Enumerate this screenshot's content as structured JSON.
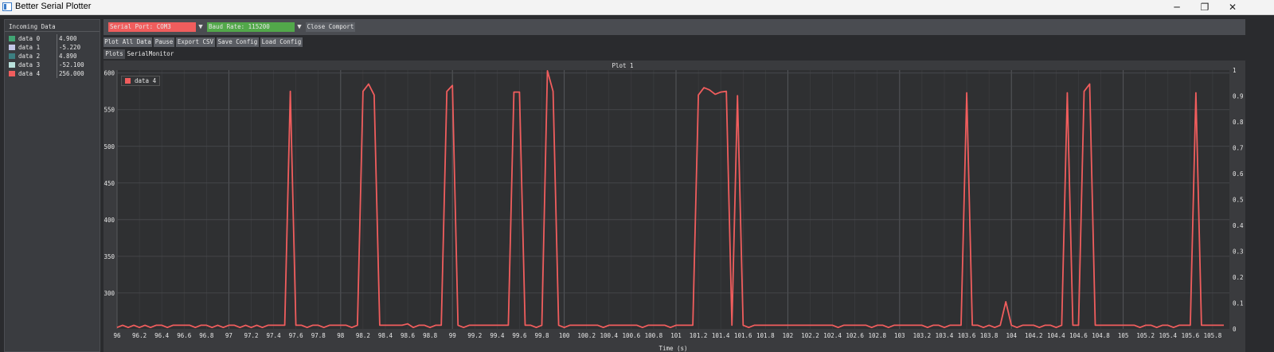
{
  "window": {
    "title": "Better Serial Plotter",
    "minimize_glyph": "─",
    "maximize_glyph": "❐",
    "close_glyph": "✕"
  },
  "incoming": {
    "title": "Incoming Data",
    "channels": [
      {
        "name": "data 0",
        "value": "4.900",
        "color": "#41a574"
      },
      {
        "name": "data 1",
        "value": "-5.220",
        "color": "#c3c6e8"
      },
      {
        "name": "data 2",
        "value": "4.890",
        "color": "#3c7f81"
      },
      {
        "name": "data 3",
        "value": "-52.100",
        "color": "#b9e1dc"
      },
      {
        "name": "data 4",
        "value": "256.000",
        "color": "#f05d5d"
      }
    ]
  },
  "toolbar": {
    "serial_port": "Serial Port: COM3",
    "baud_rate": "Baud Rate: 115200",
    "close_comport": "Close Comport",
    "plot_all": "Plot All Data",
    "pause": "Pause",
    "export_csv": "Export CSV",
    "save_config": "Save Config",
    "load_config": "Load Config",
    "tab_plots": "Plots",
    "tab_monitor": "SerialMonitor",
    "arrow_glyph": "▼"
  },
  "colors": {
    "serial_port_bg": "#f05d5d",
    "baud_rate_bg": "#52a84a",
    "line": "#f05d5d",
    "plot_bg": "#2f3032",
    "grid": "#3f4043"
  },
  "chart_data": {
    "type": "line",
    "title": "Plot 1",
    "xlabel": "Time (s)",
    "ylabel": "",
    "xlim": [
      96,
      105.95
    ],
    "ylim": [
      251,
      604
    ],
    "y2lim": [
      0,
      1
    ],
    "xticks": [
      96,
      96.2,
      96.4,
      96.6,
      96.8,
      97,
      97.2,
      97.4,
      97.6,
      97.8,
      98,
      98.2,
      98.4,
      98.6,
      98.8,
      99,
      99.2,
      99.4,
      99.6,
      99.8,
      100,
      100.2,
      100.4,
      100.6,
      100.8,
      101,
      101.2,
      101.4,
      101.6,
      101.8,
      102,
      102.2,
      102.4,
      102.6,
      102.8,
      103,
      103.2,
      103.4,
      103.6,
      103.8,
      104,
      104.2,
      104.4,
      104.6,
      104.8,
      105,
      105.2,
      105.4,
      105.6,
      105.8
    ],
    "yticks": [
      300,
      350,
      400,
      450,
      500,
      550,
      600
    ],
    "y2ticks": [
      0.1,
      0.2,
      0.3,
      0.4,
      0.5,
      0.6,
      0.7,
      0.8,
      0.9,
      1
    ],
    "series": [
      {
        "name": "data 4",
        "points": [
          [
            96,
            253
          ],
          [
            96.05,
            256
          ],
          [
            96.1,
            253
          ],
          [
            96.15,
            256
          ],
          [
            96.2,
            253
          ],
          [
            96.25,
            256
          ],
          [
            96.3,
            253
          ],
          [
            96.35,
            256
          ],
          [
            96.4,
            256
          ],
          [
            96.45,
            253
          ],
          [
            96.5,
            256
          ],
          [
            96.55,
            256
          ],
          [
            96.6,
            256
          ],
          [
            96.65,
            256
          ],
          [
            96.7,
            253
          ],
          [
            96.75,
            256
          ],
          [
            96.8,
            256
          ],
          [
            96.85,
            253
          ],
          [
            96.9,
            256
          ],
          [
            96.95,
            253
          ],
          [
            97,
            256
          ],
          [
            97.05,
            256
          ],
          [
            97.1,
            253
          ],
          [
            97.15,
            256
          ],
          [
            97.2,
            253
          ],
          [
            97.25,
            256
          ],
          [
            97.3,
            253
          ],
          [
            97.35,
            256
          ],
          [
            97.4,
            256
          ],
          [
            97.45,
            256
          ],
          [
            97.5,
            256
          ],
          [
            97.55,
            575
          ],
          [
            97.6,
            256
          ],
          [
            97.65,
            256
          ],
          [
            97.7,
            253
          ],
          [
            97.75,
            256
          ],
          [
            97.8,
            256
          ],
          [
            97.85,
            253
          ],
          [
            97.9,
            256
          ],
          [
            97.95,
            256
          ],
          [
            98,
            256
          ],
          [
            98.05,
            256
          ],
          [
            98.1,
            253
          ],
          [
            98.15,
            256
          ],
          [
            98.2,
            575
          ],
          [
            98.25,
            585
          ],
          [
            98.3,
            570
          ],
          [
            98.35,
            256
          ],
          [
            98.4,
            256
          ],
          [
            98.45,
            256
          ],
          [
            98.5,
            256
          ],
          [
            98.55,
            256
          ],
          [
            98.6,
            258
          ],
          [
            98.65,
            253
          ],
          [
            98.7,
            256
          ],
          [
            98.75,
            256
          ],
          [
            98.8,
            253
          ],
          [
            98.85,
            256
          ],
          [
            98.9,
            256
          ],
          [
            98.95,
            575
          ],
          [
            99,
            583
          ],
          [
            99.05,
            256
          ],
          [
            99.1,
            253
          ],
          [
            99.15,
            256
          ],
          [
            99.2,
            256
          ],
          [
            99.25,
            256
          ],
          [
            99.3,
            256
          ],
          [
            99.35,
            256
          ],
          [
            99.4,
            256
          ],
          [
            99.45,
            256
          ],
          [
            99.5,
            256
          ],
          [
            99.55,
            574
          ],
          [
            99.6,
            574
          ],
          [
            99.65,
            256
          ],
          [
            99.7,
            256
          ],
          [
            99.75,
            253
          ],
          [
            99.8,
            256
          ],
          [
            99.85,
            603
          ],
          [
            99.9,
            575
          ],
          [
            99.95,
            256
          ],
          [
            100,
            253
          ],
          [
            100.05,
            256
          ],
          [
            100.1,
            256
          ],
          [
            100.15,
            256
          ],
          [
            100.2,
            256
          ],
          [
            100.25,
            256
          ],
          [
            100.3,
            256
          ],
          [
            100.35,
            253
          ],
          [
            100.4,
            256
          ],
          [
            100.45,
            256
          ],
          [
            100.5,
            256
          ],
          [
            100.55,
            256
          ],
          [
            100.6,
            256
          ],
          [
            100.65,
            256
          ],
          [
            100.7,
            253
          ],
          [
            100.75,
            256
          ],
          [
            100.8,
            256
          ],
          [
            100.85,
            256
          ],
          [
            100.9,
            256
          ],
          [
            100.95,
            253
          ],
          [
            101,
            256
          ],
          [
            101.05,
            256
          ],
          [
            101.1,
            256
          ],
          [
            101.15,
            256
          ],
          [
            101.2,
            570
          ],
          [
            101.25,
            580
          ],
          [
            101.3,
            577
          ],
          [
            101.35,
            571
          ],
          [
            101.4,
            574
          ],
          [
            101.45,
            575
          ],
          [
            101.5,
            256
          ],
          [
            101.55,
            569
          ],
          [
            101.6,
            256
          ],
          [
            101.65,
            253
          ],
          [
            101.7,
            256
          ],
          [
            101.75,
            256
          ],
          [
            101.8,
            256
          ],
          [
            101.85,
            256
          ],
          [
            101.9,
            256
          ],
          [
            101.95,
            256
          ],
          [
            102,
            256
          ],
          [
            102.05,
            256
          ],
          [
            102.1,
            256
          ],
          [
            102.15,
            256
          ],
          [
            102.2,
            256
          ],
          [
            102.25,
            256
          ],
          [
            102.3,
            256
          ],
          [
            102.35,
            256
          ],
          [
            102.4,
            256
          ],
          [
            102.45,
            253
          ],
          [
            102.5,
            256
          ],
          [
            102.55,
            256
          ],
          [
            102.6,
            256
          ],
          [
            102.65,
            256
          ],
          [
            102.7,
            256
          ],
          [
            102.75,
            253
          ],
          [
            102.8,
            256
          ],
          [
            102.85,
            256
          ],
          [
            102.9,
            253
          ],
          [
            102.95,
            256
          ],
          [
            103,
            256
          ],
          [
            103.05,
            256
          ],
          [
            103.1,
            256
          ],
          [
            103.15,
            256
          ],
          [
            103.2,
            256
          ],
          [
            103.25,
            253
          ],
          [
            103.3,
            256
          ],
          [
            103.35,
            256
          ],
          [
            103.4,
            253
          ],
          [
            103.45,
            256
          ],
          [
            103.5,
            256
          ],
          [
            103.55,
            256
          ],
          [
            103.6,
            573
          ],
          [
            103.65,
            256
          ],
          [
            103.7,
            256
          ],
          [
            103.75,
            253
          ],
          [
            103.8,
            256
          ],
          [
            103.85,
            253
          ],
          [
            103.9,
            256
          ],
          [
            103.95,
            288
          ],
          [
            104,
            256
          ],
          [
            104.05,
            253
          ],
          [
            104.1,
            256
          ],
          [
            104.15,
            256
          ],
          [
            104.2,
            256
          ],
          [
            104.25,
            253
          ],
          [
            104.3,
            256
          ],
          [
            104.35,
            256
          ],
          [
            104.4,
            253
          ],
          [
            104.45,
            256
          ],
          [
            104.5,
            573
          ],
          [
            104.55,
            256
          ],
          [
            104.6,
            256
          ],
          [
            104.65,
            575
          ],
          [
            104.7,
            585
          ],
          [
            104.75,
            256
          ],
          [
            104.8,
            256
          ],
          [
            104.85,
            256
          ],
          [
            104.9,
            256
          ],
          [
            104.95,
            256
          ],
          [
            105,
            256
          ],
          [
            105.05,
            256
          ],
          [
            105.1,
            256
          ],
          [
            105.15,
            253
          ],
          [
            105.2,
            256
          ],
          [
            105.25,
            256
          ],
          [
            105.3,
            253
          ],
          [
            105.35,
            256
          ],
          [
            105.4,
            256
          ],
          [
            105.45,
            253
          ],
          [
            105.5,
            256
          ],
          [
            105.55,
            256
          ],
          [
            105.6,
            256
          ],
          [
            105.65,
            573
          ],
          [
            105.7,
            256
          ],
          [
            105.75,
            256
          ],
          [
            105.8,
            256
          ],
          [
            105.85,
            256
          ],
          [
            105.9,
            256
          ]
        ]
      }
    ]
  }
}
